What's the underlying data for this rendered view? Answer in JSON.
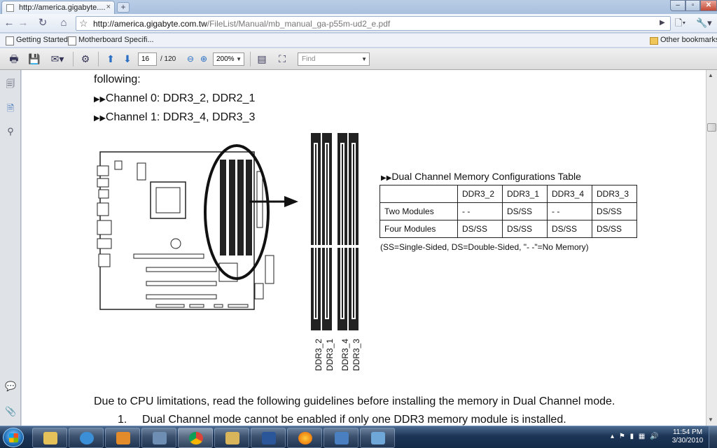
{
  "browser": {
    "tab_title": "http://america.gigabyte....",
    "tab_close": "×",
    "new_tab": "+",
    "window_controls": {
      "minimize": "–",
      "maximize": "▫",
      "close": "✕"
    },
    "url_host": "http://america.gigabyte.com.tw",
    "url_path": "/FileList/Manual/mb_manual_ga-p55m-ud2_e.pdf",
    "bookmarks": [
      "Getting Started",
      "Motherboard Specifi..."
    ],
    "other_bookmarks": "Other bookmarks"
  },
  "pdf_toolbar": {
    "page_current": "16",
    "page_total": "/ 120",
    "zoom": "200%",
    "find_placeholder": "Find"
  },
  "document": {
    "line_following": "following:",
    "channel0": "Channel 0: DDR3_2, DDR2_1",
    "channel1": "Channel 1: DDR3_4, DDR3_3",
    "table_title": "Dual Channel Memory Configurations Table",
    "table_headers": [
      "",
      "DDR3_2",
      "DDR3_1",
      "DDR3_4",
      "DDR3_3"
    ],
    "table_rows": [
      [
        "Two Modules",
        "- -",
        "DS/SS",
        "- -",
        "DS/SS"
      ],
      [
        "Four Modules",
        "DS/SS",
        "DS/SS",
        "DS/SS",
        "DS/SS"
      ]
    ],
    "legend_note": "(SS=Single-Sided, DS=Double-Sided, \"- -\"=No Memory)",
    "slot_labels": [
      "DDR3_2",
      "DDR3_1",
      "DDR3_4",
      "DDR3_3"
    ],
    "cpu_limit_text": "Due to CPU limitations, read the following guidelines before installing the memory in Dual Channel mode.",
    "item1_number": "1.",
    "item1_text": "Dual Channel mode cannot be enabled if only one DDR3 memory module is installed."
  },
  "taskbar": {
    "time": "11:54 PM",
    "date": "3/30/2010"
  }
}
